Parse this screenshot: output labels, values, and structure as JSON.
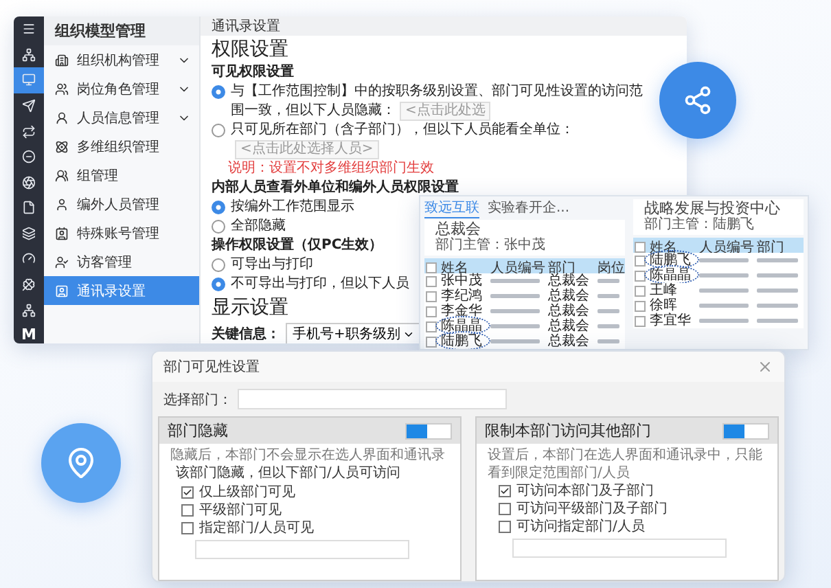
{
  "rail": {
    "items": [
      {
        "selected": false
      },
      {
        "selected": true
      },
      {
        "selected": false
      },
      {
        "selected": false
      },
      {
        "selected": false
      },
      {
        "selected": false
      },
      {
        "selected": false
      },
      {
        "selected": false
      },
      {
        "selected": false
      },
      {
        "selected": false
      },
      {
        "selected": false
      }
    ],
    "logo": "M"
  },
  "sidebar": {
    "title": "组织模型管理",
    "items": [
      {
        "label": "组织机构管理",
        "has_submenu": true,
        "selected": false
      },
      {
        "label": "岗位角色管理",
        "has_submenu": true,
        "selected": false
      },
      {
        "label": "人员信息管理",
        "has_submenu": true,
        "selected": false
      },
      {
        "label": "多维组织管理",
        "has_submenu": false,
        "selected": false
      },
      {
        "label": "组管理",
        "has_submenu": false,
        "selected": false
      },
      {
        "label": "编外人员管理",
        "has_submenu": false,
        "selected": false
      },
      {
        "label": "特殊账号管理",
        "has_submenu": false,
        "selected": false
      },
      {
        "label": "访客管理",
        "has_submenu": false,
        "selected": false
      },
      {
        "label": "通讯录设置",
        "has_submenu": false,
        "selected": true
      }
    ]
  },
  "content": {
    "breadcrumb": "通讯录设置",
    "blocks": [
      {
        "kind": "heading",
        "text": "权限设置"
      },
      {
        "kind": "subheading",
        "text": "可见权限设置"
      },
      {
        "kind": "radio",
        "text": "与【工作范围控制】中的按职务级别设置、部门可见性设置的访问范围一致，但以下人员隐藏：",
        "selected": true,
        "placeholder": "<点击此处选"
      },
      {
        "kind": "radio",
        "text": "只可见所在部门（含子部门），但以下人员能看全单位：",
        "selected": false,
        "placeholder": "<点击此处选择人员>"
      },
      {
        "kind": "note",
        "text": "说明：设置不对多维组织部门生效"
      },
      {
        "kind": "subheading",
        "text": "内部人员查看外单位和编外人员权限设置"
      },
      {
        "kind": "radio",
        "text": "按编外工作范围显示",
        "selected": true
      },
      {
        "kind": "radio",
        "text": "全部隐藏",
        "selected": false
      },
      {
        "kind": "subheading",
        "text": "操作权限设置（仅PC生效）"
      },
      {
        "kind": "radio",
        "text": "可导出与打印",
        "selected": false
      },
      {
        "kind": "radio",
        "text": "不可导出与打印，但以下人员",
        "selected": true
      },
      {
        "kind": "heading",
        "text": "显示设置"
      },
      {
        "kind": "select",
        "label": "关键信息：",
        "value": "手机号+职务级别"
      }
    ]
  },
  "directory": {
    "tabs": [
      {
        "label": "致远互联",
        "selected": true
      },
      {
        "label": "实验春开企...",
        "selected": false
      }
    ],
    "panes": [
      {
        "title": "总裁会",
        "manager": "部门主管：张中茂",
        "columns": [
          "姓名",
          "人员编号",
          "部门",
          "岗位"
        ],
        "rows": [
          {
            "name": "张中茂",
            "dept": "总裁会",
            "circled": false,
            "checked": false
          },
          {
            "name": "李纪鸿",
            "dept": "总裁会",
            "circled": false,
            "checked": false
          },
          {
            "name": "李金华",
            "dept": "总裁会",
            "circled": false,
            "checked": false
          },
          {
            "name": "陈晶晶",
            "dept": "总裁会",
            "circled": true,
            "checked": false
          },
          {
            "name": "陆鹏飞",
            "dept": "总裁会",
            "circled": true,
            "checked": false
          }
        ],
        "all_checked": false
      },
      {
        "title": "战略发展与投资中心",
        "manager": "部门主管：陆鹏飞",
        "columns": [
          "姓名",
          "人员编号",
          "部门"
        ],
        "rows": [
          {
            "name": "陆鹏飞",
            "circled": true,
            "checked": false
          },
          {
            "name": "陈晶晶",
            "circled": true,
            "checked": false
          },
          {
            "name": "王峰",
            "circled": false,
            "checked": false
          },
          {
            "name": "徐晖",
            "circled": false,
            "checked": false
          },
          {
            "name": "李宜华",
            "circled": false,
            "checked": false
          }
        ],
        "all_checked": false
      }
    ]
  },
  "dialog": {
    "title": "部门可见性设置",
    "select_label": "选择部门：",
    "panels": [
      {
        "title": "部门隐藏",
        "on": true,
        "description": "隐藏后，本部门不会显示在选人界面和通讯录",
        "intro": "该部门隐藏，但以下部门/人员可访问",
        "options": [
          {
            "label": "仅上级部门可见",
            "checked": true
          },
          {
            "label": "平级部门可见",
            "checked": false
          },
          {
            "label": "指定部门/人员可见",
            "checked": false
          }
        ]
      },
      {
        "title": "限制本部门访问其他部门",
        "on": true,
        "description": "设置后，本部门在选人界面和通讯录中，只能看到限定范围部门/人员",
        "options": [
          {
            "label": "可访问本部门及子部门",
            "checked": true
          },
          {
            "label": "可访问平级部门及子部门",
            "checked": false
          },
          {
            "label": "可访问指定部门/人员",
            "checked": false
          }
        ]
      }
    ]
  }
}
